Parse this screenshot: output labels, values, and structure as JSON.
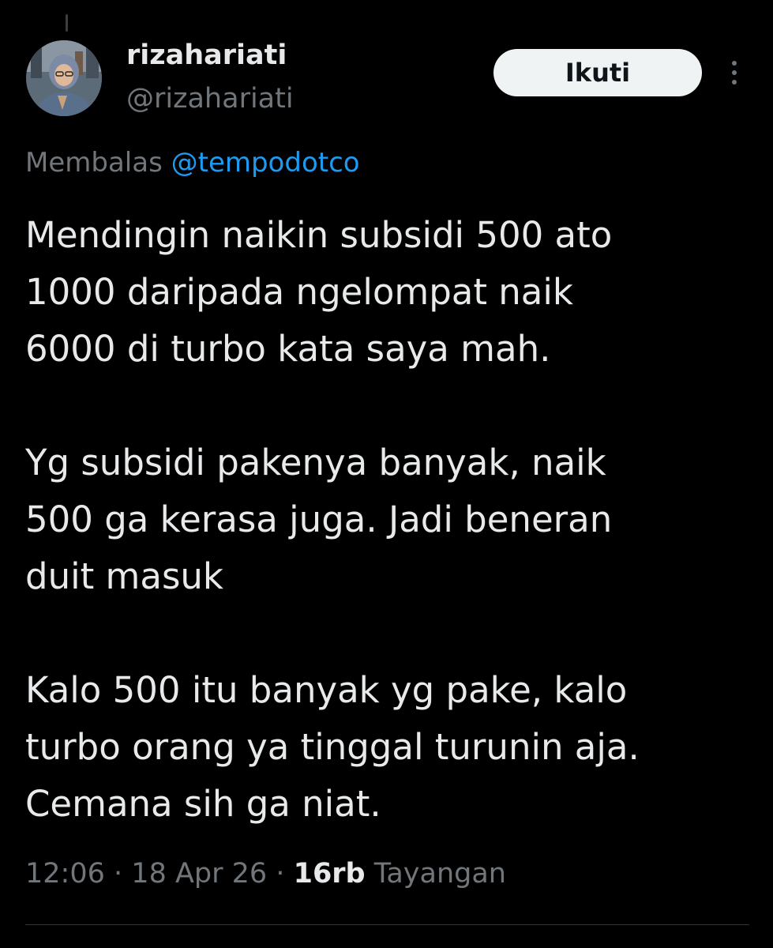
{
  "user": {
    "display_name": "rizahariati",
    "handle": "@rizahariati"
  },
  "follow_button": {
    "label": "Ikuti"
  },
  "reply": {
    "prefix": "Membalas",
    "mention": "@tempodotco"
  },
  "tweet": {
    "paragraphs": [
      {
        "lines": [
          "Mendingin naikin subsidi 500 ato",
          "1000 daripada ngelompat naik",
          "6000 di turbo kata saya mah."
        ]
      },
      {
        "lines": [
          "Yg subsidi pakenya banyak, naik",
          "500 ga kerasa juga. Jadi beneran",
          "duit masuk"
        ]
      },
      {
        "lines": [
          "Kalo 500 itu banyak yg pake, kalo",
          "turbo orang ya tinggal turunin aja.",
          "Cemana sih ga niat."
        ]
      }
    ]
  },
  "meta": {
    "time": "12:06",
    "date": "18 Apr 26",
    "views_count": "16rb",
    "views_label": "Tayangan",
    "separator": "·"
  },
  "colors": {
    "background": "#000000",
    "text_primary": "#e7e9ea",
    "text_secondary": "#71767b",
    "link": "#1d9bf0",
    "button_bg": "#eff3f4",
    "button_text": "#0f1419",
    "divider": "#2f3336"
  },
  "icons": {
    "more": "more-vertical-icon"
  }
}
